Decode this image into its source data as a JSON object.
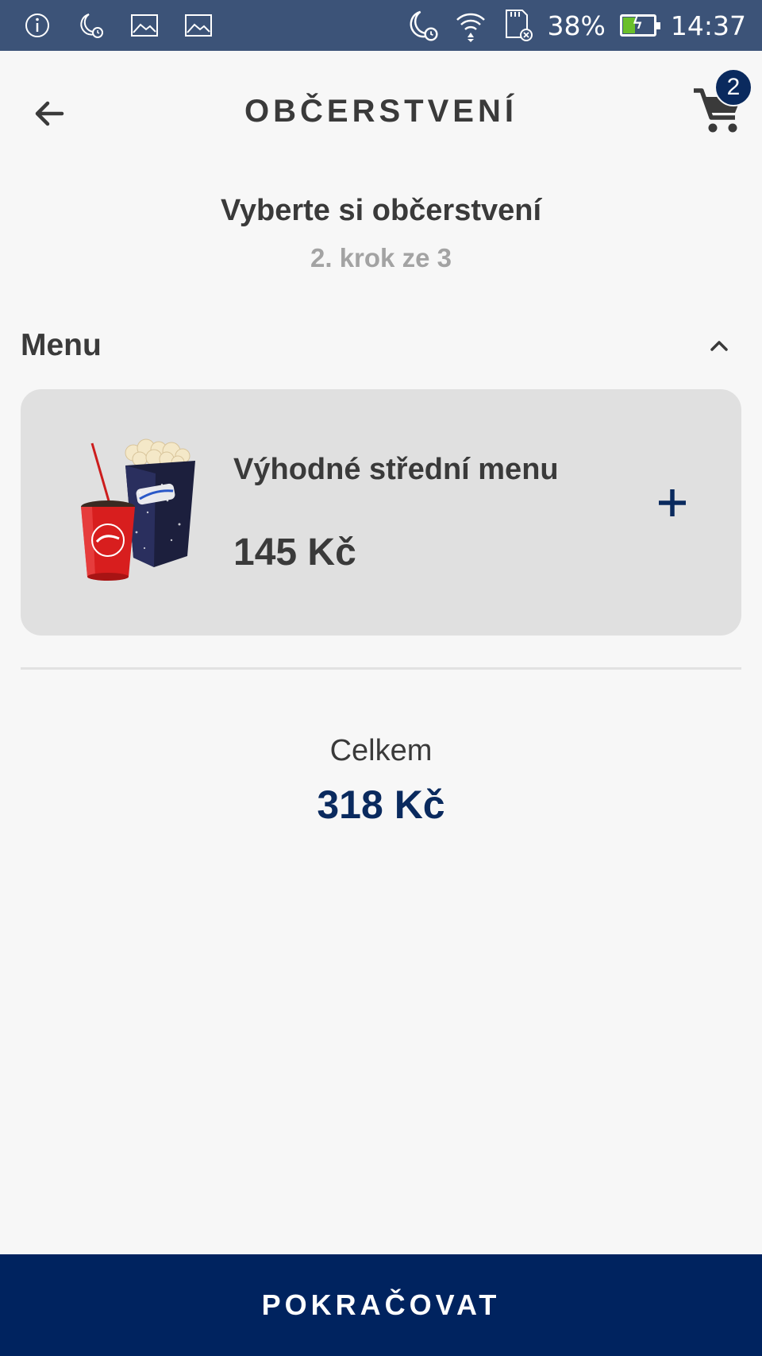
{
  "status_bar": {
    "battery_text": "38%",
    "battery_level": 0.38,
    "time": "14:37",
    "icons_left": [
      "info-icon",
      "moon-alarm-icon",
      "image-icon",
      "image-icon"
    ],
    "icons_right": [
      "moon-alarm-icon",
      "wifi-icon",
      "sd-card-icon",
      "battery-icon"
    ]
  },
  "app_bar": {
    "title": "OBČERSTVENÍ",
    "cart_count": "2"
  },
  "step": {
    "title": "Vyberte si občerstvení",
    "subtitle": "2. krok ze 3"
  },
  "section": {
    "label": "Menu",
    "expanded": true
  },
  "product": {
    "name": "Výhodné střední menu",
    "price": "145 Kč",
    "image": "popcorn-and-drink-image",
    "image_lettering": [
      "CineStar",
      "Coca-Cola"
    ]
  },
  "total": {
    "label": "Celkem",
    "value": "318 Kč"
  },
  "footer": {
    "continue_label": "POKRAČOVAT"
  },
  "colors": {
    "status_bar": "#3c5378",
    "accent": "#0a2a5e",
    "button": "#00235f",
    "card": "#e0e0e0",
    "background": "#f7f7f7"
  }
}
